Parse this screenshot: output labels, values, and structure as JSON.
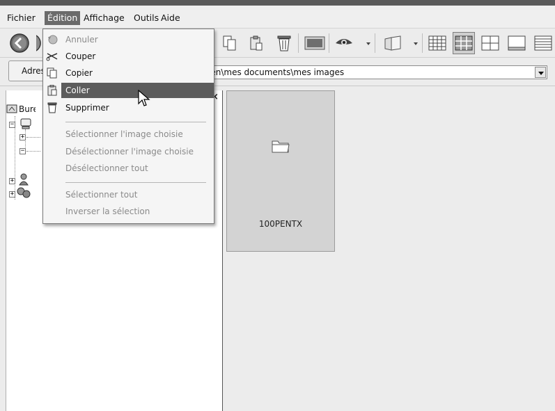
{
  "menubar": {
    "items": [
      "Fichier",
      "Édition",
      "Affichage",
      "Outils",
      "Aide"
    ],
    "active_index": 1
  },
  "addressbar": {
    "label": "Adresse",
    "path": "een\\mes documents\\mes images"
  },
  "tree": {
    "root_label": "Bureau"
  },
  "edit_menu": {
    "items": [
      {
        "label": "Annuler",
        "icon": "undo-icon",
        "enabled": false
      },
      {
        "label": "Couper",
        "icon": "scissors-icon",
        "enabled": true
      },
      {
        "label": "Copier",
        "icon": "copy-icon",
        "enabled": true
      },
      {
        "label": "Coller",
        "icon": "paste-icon",
        "enabled": true,
        "highlighted": true
      },
      {
        "label": "Supprimer",
        "icon": "trash-icon",
        "enabled": true
      },
      {
        "label": "Sélectionner l'image choisie",
        "enabled": false
      },
      {
        "label": "Désélectionner l'image choisie",
        "enabled": false
      },
      {
        "label": "Désélectionner tout",
        "enabled": false
      },
      {
        "label": "Sélectionner tout",
        "enabled": false
      },
      {
        "label": "Inverser la sélection",
        "enabled": false
      }
    ]
  },
  "content": {
    "folder_name": "100PENTX"
  },
  "colors": {
    "menu_highlight": "#5c5c5c",
    "background": "#ececec"
  }
}
